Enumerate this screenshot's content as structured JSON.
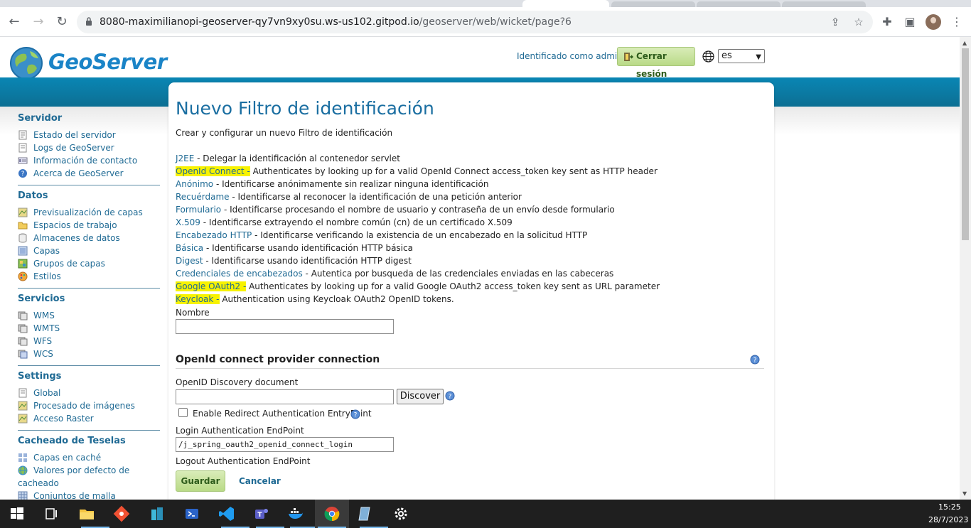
{
  "browser": {
    "url_host": "8080-maximilianopi-geoserver-qy7vn9xy0su.ws-us102.gitpod.io",
    "url_path": "/geoserver/web/wicket/page?6"
  },
  "header": {
    "logo_text": "GeoServer",
    "login_status": "Identificado como admin.",
    "logout_label": "Cerrar sesión",
    "language": "es"
  },
  "sidebar": {
    "groups": [
      {
        "title": "Servidor",
        "items": [
          {
            "label": "Estado del servidor",
            "icon": "server-status-icon"
          },
          {
            "label": "Logs de GeoServer",
            "icon": "log-icon"
          },
          {
            "label": "Información de contacto",
            "icon": "contact-icon"
          },
          {
            "label": "Acerca de GeoServer",
            "icon": "about-icon"
          }
        ]
      },
      {
        "title": "Datos",
        "items": [
          {
            "label": "Previsualización de capas",
            "icon": "layer-preview-icon"
          },
          {
            "label": "Espacios de trabajo",
            "icon": "workspace-icon"
          },
          {
            "label": "Almacenes de datos",
            "icon": "store-icon"
          },
          {
            "label": "Capas",
            "icon": "layer-icon"
          },
          {
            "label": "Grupos de capas",
            "icon": "layer-group-icon"
          },
          {
            "label": "Estilos",
            "icon": "style-icon"
          }
        ]
      },
      {
        "title": "Servicios",
        "items": [
          {
            "label": "WMS",
            "icon": "wms-icon"
          },
          {
            "label": "WMTS",
            "icon": "wmts-icon"
          },
          {
            "label": "WFS",
            "icon": "wfs-icon"
          },
          {
            "label": "WCS",
            "icon": "wcs-icon"
          }
        ]
      },
      {
        "title": "Settings",
        "items": [
          {
            "label": "Global",
            "icon": "global-icon"
          },
          {
            "label": "Procesado de imágenes",
            "icon": "image-processing-icon"
          },
          {
            "label": "Acceso Raster",
            "icon": "raster-access-icon"
          }
        ]
      },
      {
        "title": "Cacheado de Teselas",
        "items": [
          {
            "label": "Capas en caché",
            "icon": "cached-layers-icon"
          },
          {
            "label": "Valores por defecto de",
            "icon": "caching-defaults-icon"
          },
          {
            "label": "cacheado",
            "icon": ""
          },
          {
            "label": "Conjuntos de malla",
            "icon": "gridsets-icon"
          }
        ]
      }
    ]
  },
  "main": {
    "title": "Nuevo Filtro de identificación",
    "description": "Crear y configurar un nuevo Filtro de identificación",
    "filters": [
      {
        "name": "J2EE",
        "desc": " - Delegar la identificación al contenedor servlet",
        "highlight": false
      },
      {
        "name": "OpenId Connect",
        "desc": " Authenticates by looking up for a valid OpenId Connect access_token key sent as HTTP header",
        "highlight": true
      },
      {
        "name": "Anónimo",
        "desc": " - Identificarse anónimamente sin realizar ninguna identificación",
        "highlight": false
      },
      {
        "name": "Recuérdame",
        "desc": " - Identificarse al reconocer la identificación de una petición anterior",
        "highlight": false
      },
      {
        "name": "Formulario",
        "desc": " - Identificarse procesando el nombre de usuario y contraseña de un envío desde formulario",
        "highlight": false
      },
      {
        "name": "X.509",
        "desc": " - Identificarse extrayendo el nombre común (cn) de un certificado X.509",
        "highlight": false
      },
      {
        "name": "Encabezado HTTP",
        "desc": " - Identificarse verificando la existencia de un encabezado en la solicitud HTTP",
        "highlight": false
      },
      {
        "name": "Básica",
        "desc": " - Identificarse usando identificación HTTP básica",
        "highlight": false
      },
      {
        "name": "Digest",
        "desc": " - Identificarse usando identificación HTTP digest",
        "highlight": false
      },
      {
        "name": "Credenciales de encabezados",
        "desc": " - Autentica por busqueda de las credenciales enviadas en las cabeceras",
        "highlight": false
      },
      {
        "name": "Google OAuth2",
        "desc": " Authenticates by looking up for a valid Google OAuth2 access_token key sent as URL parameter",
        "highlight": true
      },
      {
        "name": "Keycloak",
        "desc": " Authentication using Keycloak OAuth2 OpenID tokens.",
        "highlight": true
      }
    ],
    "name_label": "Nombre",
    "name_value": "",
    "section_title": "OpenId connect provider connection",
    "discovery_label": "OpenID Discovery document",
    "discovery_value": "",
    "discover_button": "Discover",
    "redirect_label": "Enable Redirect Authentication EntryPoint",
    "login_endpoint_label": "Login Authentication EndPoint",
    "login_endpoint_value": "/j_spring_oauth2_openid_connect_login",
    "logout_endpoint_label": "Logout Authentication EndPoint",
    "save_label": "Guardar",
    "cancel_label": "Cancelar"
  },
  "taskbar": {
    "time": "15:25",
    "date": "28/7/2023"
  },
  "colors": {
    "accent": "#1a84c7",
    "band": "#0c7aa3",
    "highlight": "#f7f200",
    "link": "#1f6a94"
  }
}
